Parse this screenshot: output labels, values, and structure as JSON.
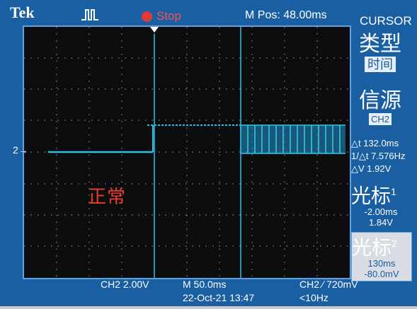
{
  "header": {
    "brand": "Tek",
    "run_status": "Stop",
    "m_pos": "M Pos: 48.00ms"
  },
  "menu": {
    "title": "CURSOR",
    "type_label": "类型",
    "type_value": "时间",
    "source_label": "信源",
    "source_value": "CH2",
    "delta_t": "△t 132.0ms",
    "inv_delta_t": "1/△t 7.576Hz",
    "delta_v": "△V 1.92V",
    "cursor1_label": "光标",
    "cursor1_index": "1",
    "cursor1_time": "-2.00ms",
    "cursor1_volt": "1.84V",
    "cursor2_label": "光标",
    "cursor2_index": "2",
    "cursor2_time": "130ms",
    "cursor2_volt": "-80.0mV"
  },
  "screen": {
    "annotation": "正常",
    "channel_marker": "2→"
  },
  "footer": {
    "ch2_scale": "CH2  2.00V",
    "timebase": "M 50.0ms",
    "date": "22-Oct-21 13:47",
    "trigger": "CH2 ∕ 720mV",
    "trigger_freq": "<10Hz"
  },
  "colors": {
    "background": "#1a5fa2",
    "graticule": "#0b0d0f",
    "trace": "#2fc0e0",
    "cursor": "#25b5e5",
    "status": "#e23a3a",
    "annotation": "#f03b2c"
  }
}
